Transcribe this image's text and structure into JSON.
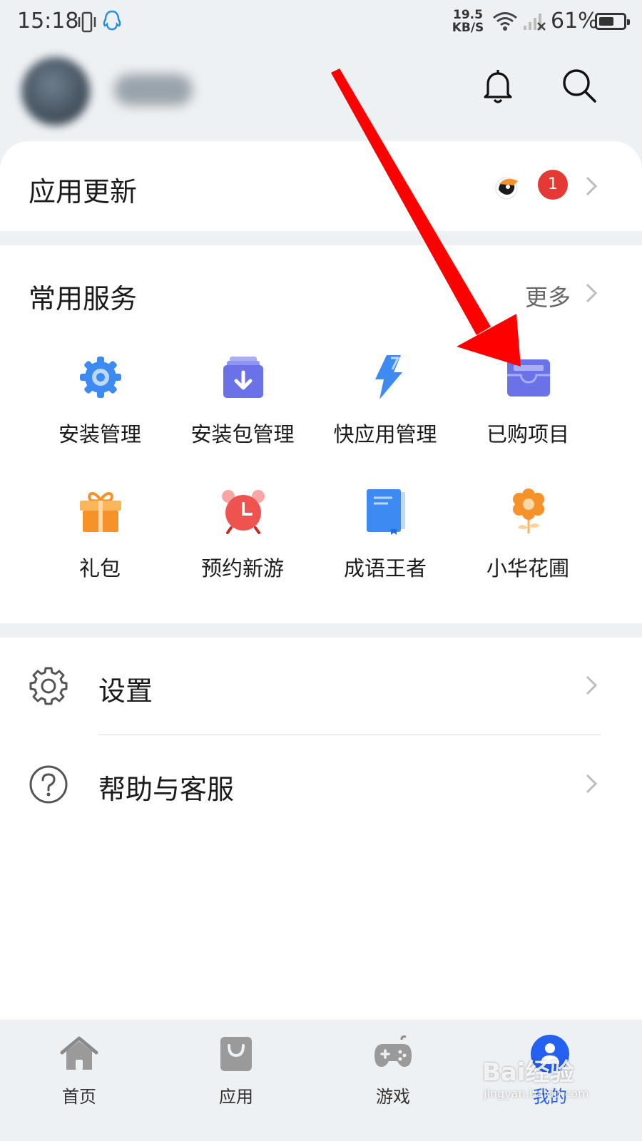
{
  "status_bar": {
    "time": "15:18",
    "net_speed_value": "19.5",
    "net_speed_unit": "KB/S",
    "battery": "61%",
    "battery_level": 0.61
  },
  "header": {
    "bell_icon": "bell-icon",
    "search_icon": "search-icon"
  },
  "app_update": {
    "title": "应用更新",
    "badge_count": "1",
    "app_icon": "toucan-app-icon"
  },
  "services": {
    "title": "常用服务",
    "more_label": "更多",
    "items": [
      {
        "label": "安装管理",
        "icon": "gear-icon",
        "color": "#3d8bf2"
      },
      {
        "label": "安装包管理",
        "icon": "package-download-icon",
        "color": "#6b72e8"
      },
      {
        "label": "快应用管理",
        "icon": "lightning-icon",
        "color": "#3d8bf2"
      },
      {
        "label": "已购项目",
        "icon": "wallet-icon",
        "color": "#6b72e8"
      },
      {
        "label": "礼包",
        "icon": "gift-icon",
        "color": "#f5922a"
      },
      {
        "label": "预约新游",
        "icon": "alarm-clock-icon",
        "color": "#ef5350"
      },
      {
        "label": "成语王者",
        "icon": "book-icon",
        "color": "#3d8bf2"
      },
      {
        "label": "小华花圃",
        "icon": "flower-icon",
        "color": "#f5922a"
      }
    ]
  },
  "settings": {
    "items": [
      {
        "label": "设置",
        "icon": "settings-icon"
      },
      {
        "label": "帮助与客服",
        "icon": "help-icon"
      }
    ]
  },
  "bottom_nav": {
    "items": [
      {
        "label": "首页",
        "icon": "home-icon"
      },
      {
        "label": "应用",
        "icon": "bag-icon"
      },
      {
        "label": "游戏",
        "icon": "gamepad-icon"
      },
      {
        "label": "我的",
        "icon": "profile-icon",
        "active": true
      }
    ]
  },
  "watermark": {
    "line1": "Bai经验",
    "line2": "jingyan.baidu.com"
  },
  "colors": {
    "accent": "#2561f0",
    "badge": "#e53935",
    "arrow": "#ff0000"
  }
}
